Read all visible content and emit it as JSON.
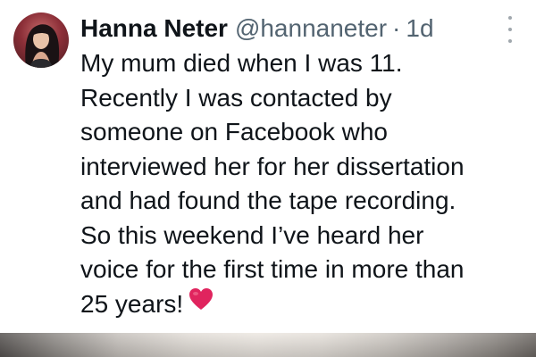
{
  "tweet": {
    "author": {
      "display_name": "Hanna Neter",
      "handle": "@hannaneter",
      "avatar_icon": "profile-photo"
    },
    "separator": "·",
    "timestamp": "1d",
    "more_icon": "more-vertical-icon",
    "text_lines": [
      "My mum died when I was 11.",
      "Recently I was contacted by",
      "someone on Facebook who",
      "interviewed her for her dissertation",
      "and had found the tape recording.",
      "So this weekend I’ve heard her",
      "voice for the first time in more than",
      "25 years!"
    ],
    "emoji": "heart-emoji",
    "colors": {
      "name": "#0f1419",
      "secondary": "#536471",
      "heart": "#e0245e"
    }
  }
}
